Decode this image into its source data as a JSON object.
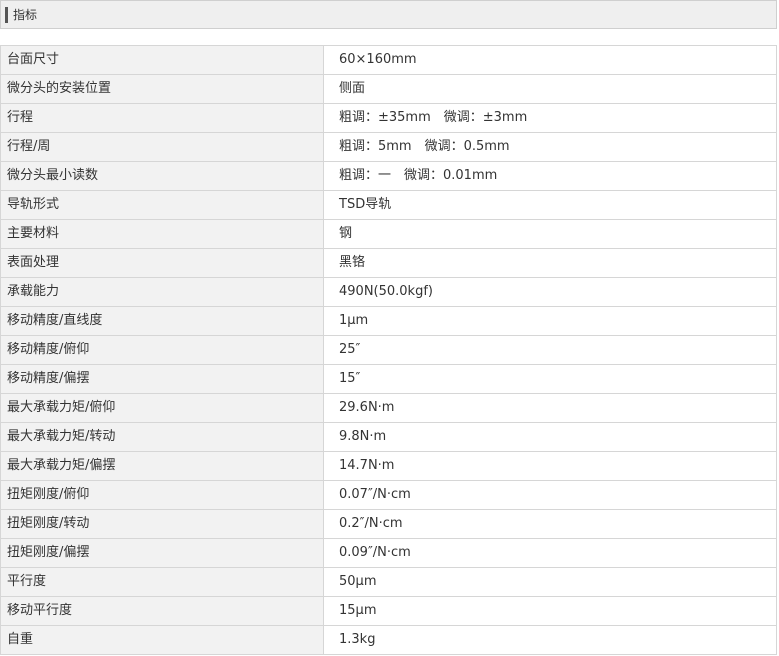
{
  "section": {
    "title": "指标"
  },
  "specs": [
    {
      "label": "台面尺寸",
      "value": "60×160mm"
    },
    {
      "label": "微分头的安装位置",
      "value": "侧面"
    },
    {
      "label": "行程",
      "value": "粗调：±35mm　微调：±3mm"
    },
    {
      "label": "行程/周",
      "value": "粗调：5mm　微调：0.5mm"
    },
    {
      "label": "微分头最小读数",
      "value": "粗调：一　微调：0.01mm"
    },
    {
      "label": "导轨形式",
      "value": "TSD导轨"
    },
    {
      "label": "主要材料",
      "value": "钢"
    },
    {
      "label": "表面处理",
      "value": "黑铬"
    },
    {
      "label": "承载能力",
      "value": "490N(50.0kgf)"
    },
    {
      "label": "移动精度/直线度",
      "value": "1μm"
    },
    {
      "label": "移动精度/俯仰",
      "value": "25″"
    },
    {
      "label": "移动精度/偏摆",
      "value": "15″"
    },
    {
      "label": "最大承载力矩/俯仰",
      "value": "29.6N·m"
    },
    {
      "label": "最大承载力矩/转动",
      "value": "9.8N·m"
    },
    {
      "label": "最大承载力矩/偏摆",
      "value": "14.7N·m"
    },
    {
      "label": "扭矩刚度/俯仰",
      "value": "0.07″/N·cm"
    },
    {
      "label": "扭矩刚度/转动",
      "value": "0.2″/N·cm"
    },
    {
      "label": "扭矩刚度/偏摆",
      "value": "0.09″/N·cm"
    },
    {
      "label": "平行度",
      "value": "50μm"
    },
    {
      "label": "移动平行度",
      "value": "15μm"
    },
    {
      "label": "自重",
      "value": "1.3kg"
    }
  ]
}
